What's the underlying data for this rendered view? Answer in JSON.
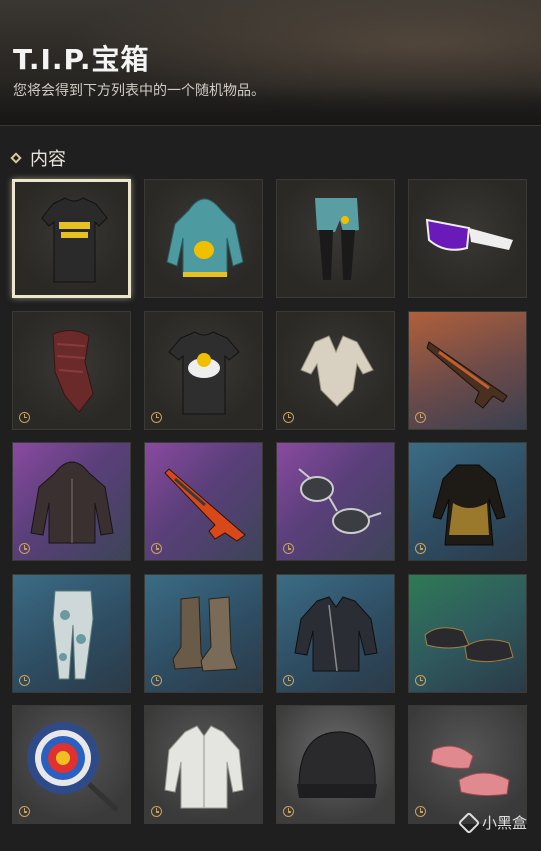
{
  "header": {
    "title": "T.I.P.宝箱",
    "subtitle": "您将会得到下方列表中的一个随机物品。"
  },
  "section": {
    "label": "内容"
  },
  "items": [
    {
      "name": "t-shirt-yellow-text-icon",
      "bg": "dark",
      "timer": false,
      "selected": true
    },
    {
      "name": "teal-hoodie-icon",
      "bg": "dark",
      "timer": false
    },
    {
      "name": "teal-pants-icon",
      "bg": "dark",
      "timer": false
    },
    {
      "name": "purple-sunglasses-icon",
      "bg": "dark",
      "timer": false
    },
    {
      "name": "red-scarf-mask-icon",
      "bg": "dark",
      "timer": true
    },
    {
      "name": "chick-print-t-shirt-icon",
      "bg": "dark",
      "timer": true
    },
    {
      "name": "cream-tied-blouse-icon",
      "bg": "dark",
      "timer": true
    },
    {
      "name": "rifle-skin-icon",
      "bg": "orange",
      "timer": true
    },
    {
      "name": "leather-hooded-jacket-icon",
      "bg": "purple",
      "timer": true
    },
    {
      "name": "shotgun-skin-icon",
      "bg": "purple",
      "timer": true
    },
    {
      "name": "aviator-sunglasses-icon",
      "bg": "purple",
      "timer": true
    },
    {
      "name": "qipao-dress-icon",
      "bg": "blue",
      "timer": true
    },
    {
      "name": "camo-pants-icon",
      "bg": "blue",
      "timer": true
    },
    {
      "name": "combat-boots-icon",
      "bg": "blue",
      "timer": true
    },
    {
      "name": "biker-jacket-icon",
      "bg": "blue",
      "timer": true
    },
    {
      "name": "embroidered-shoes-icon",
      "bg": "green",
      "timer": true
    },
    {
      "name": "target-frying-pan-icon",
      "bg": "gray",
      "timer": true
    },
    {
      "name": "white-shirt-icon",
      "bg": "gray",
      "timer": true
    },
    {
      "name": "beanie-hat-icon",
      "bg": "light",
      "timer": true
    },
    {
      "name": "pink-slippers-icon",
      "bg": "gray",
      "timer": true
    }
  ],
  "colors": {
    "accent": "#c8a060",
    "selected_border": "#ece6cc"
  },
  "watermark": {
    "text": "小黑盒",
    "icon": "xiaoheihe-logo-icon"
  }
}
